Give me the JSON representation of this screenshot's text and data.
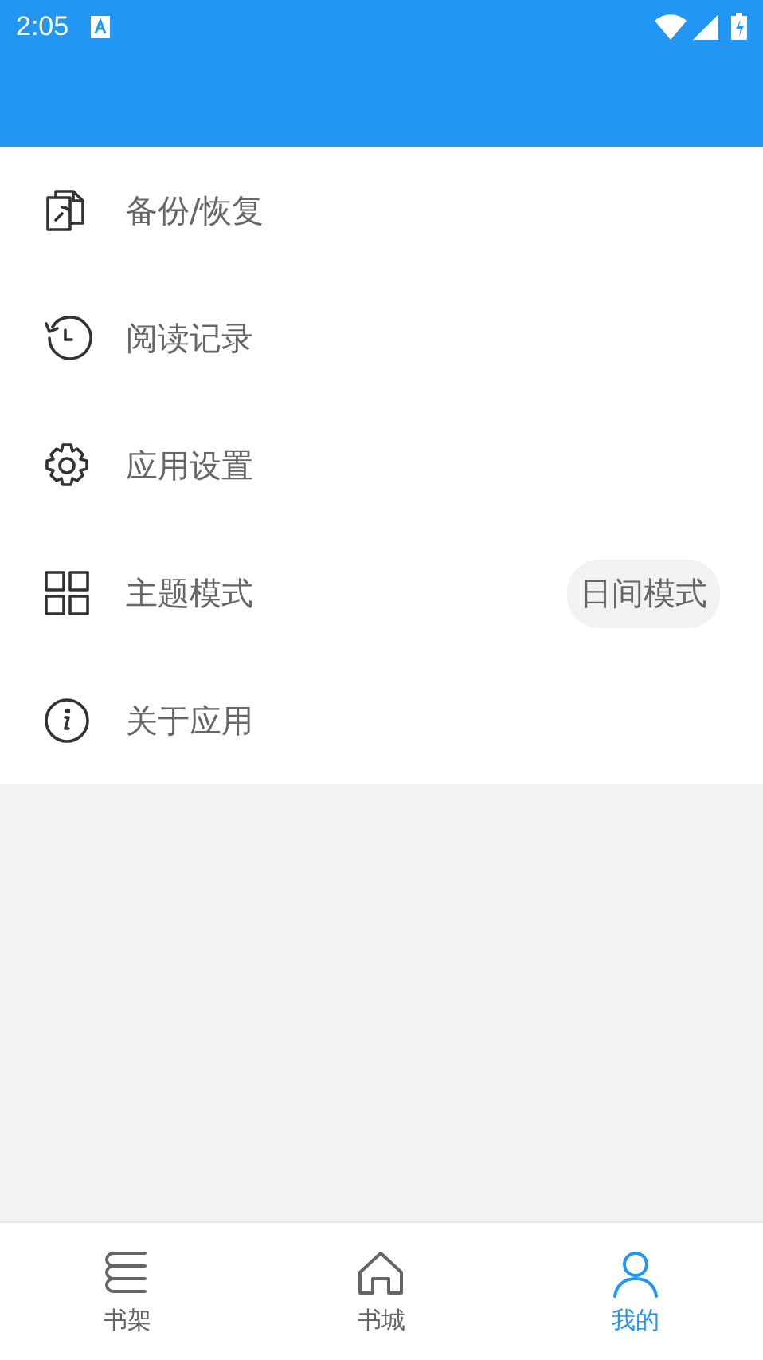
{
  "status_bar": {
    "time": "2:05"
  },
  "menu": [
    {
      "kind": "backup",
      "label": "备份/恢复"
    },
    {
      "kind": "history",
      "label": "阅读记录"
    },
    {
      "kind": "settings",
      "label": "应用设置"
    },
    {
      "kind": "theme",
      "label": "主题模式",
      "value": "日间模式"
    },
    {
      "kind": "about",
      "label": "关于应用"
    }
  ],
  "tabs": [
    {
      "kind": "shelf",
      "label": "书架",
      "selected": false
    },
    {
      "kind": "store",
      "label": "书城",
      "selected": false
    },
    {
      "kind": "profile",
      "label": "我的",
      "selected": true
    }
  ]
}
